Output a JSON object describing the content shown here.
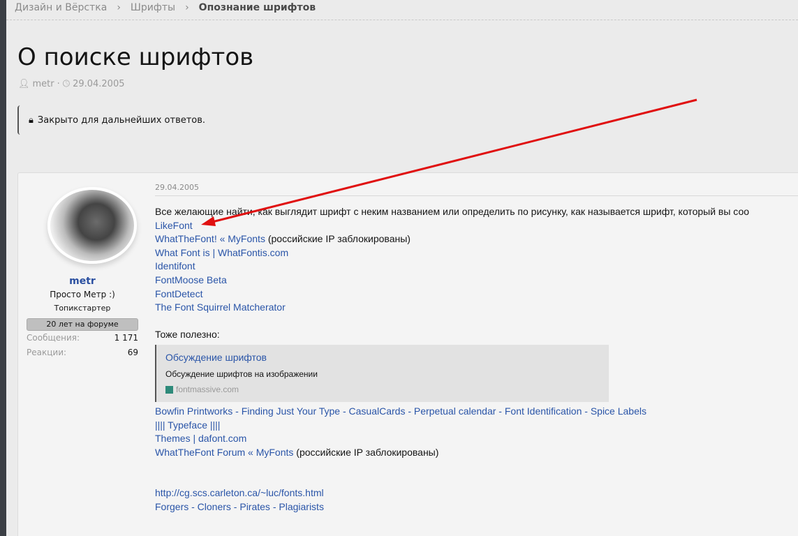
{
  "breadcrumb": [
    "Дизайн и Вёрстка",
    "Шрифты",
    "Опознание шрифтов"
  ],
  "title": "О поиске шрифтов",
  "meta": {
    "author": "metr",
    "date": "29.04.2005"
  },
  "notice": "Закрыто для дальнейших ответов.",
  "user": {
    "name": "metr",
    "title": "Просто Метр :)",
    "role": "Топикстартер",
    "badge": "20 лет на форуме",
    "messages_label": "Сообщения:",
    "messages": "1 171",
    "reactions_label": "Реакции:",
    "reactions": "69"
  },
  "post": {
    "date": "29.04.2005",
    "intro": "Все желающие найти, как выглядит шрифт с неким названием или определить по рисунку, как называется шрифт, который вы соо",
    "links1": [
      "LikeFont",
      "WhatTheFont! « MyFonts",
      "What Font is | WhatFontis.com",
      "Identifont",
      "FontMoose Beta",
      "FontDetect",
      "The Font Squirrel Matcherator"
    ],
    "blocked_note": "(российские IP заблокированы)",
    "also": "Тоже полезно:",
    "unfurl": {
      "title": "Обсуждение шрифтов",
      "desc": "Обсуждение шрифтов на изображении",
      "site": "fontmassive.com"
    },
    "links2": [
      "Bowfin Printworks - Finding Just Your Type - CasualCards - Perpetual calendar - Font Identification - Spice Labels",
      "|||| Typeface ||||",
      "Themes | dafont.com",
      "WhatTheFont Forum « MyFonts"
    ],
    "links3": [
      "http://cg.scs.carleton.ca/~luc/fonts.html",
      "Forgers - Cloners - Pirates - Plagiarists"
    ]
  },
  "annotation_color": "#e01010"
}
